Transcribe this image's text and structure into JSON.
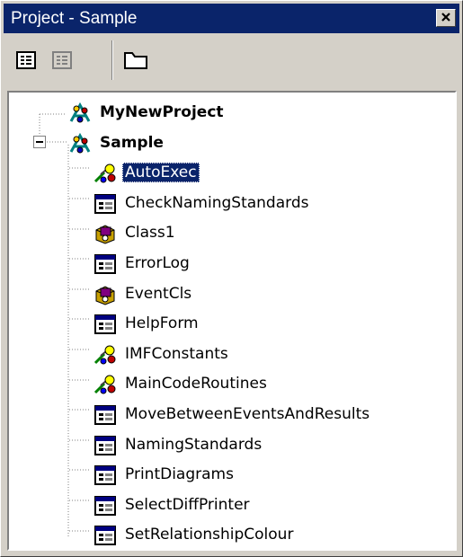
{
  "window": {
    "title": "Project - Sample",
    "accent_color": "#0a246a"
  },
  "toolbar": {
    "buttons": [
      {
        "name": "view-code-icon",
        "enabled": true
      },
      {
        "name": "view-object-icon",
        "enabled": false
      },
      {
        "name": "toggle-folders-icon",
        "enabled": true
      }
    ]
  },
  "tree": {
    "selected": "AutoExec",
    "projects": [
      {
        "label": "MyNewProject",
        "expanded": false,
        "icon": "project-icon"
      },
      {
        "label": "Sample",
        "expanded": true,
        "icon": "project-icon",
        "children": [
          {
            "label": "AutoExec",
            "icon": "macro-icon"
          },
          {
            "label": "CheckNamingStandards",
            "icon": "form-icon"
          },
          {
            "label": "Class1",
            "icon": "class-module-icon"
          },
          {
            "label": "ErrorLog",
            "icon": "form-icon"
          },
          {
            "label": "EventCls",
            "icon": "class-module-icon"
          },
          {
            "label": "HelpForm",
            "icon": "form-icon"
          },
          {
            "label": "IMFConstants",
            "icon": "macro-icon"
          },
          {
            "label": "MainCodeRoutines",
            "icon": "macro-icon"
          },
          {
            "label": "MoveBetweenEventsAndResults",
            "icon": "form-icon"
          },
          {
            "label": "NamingStandards",
            "icon": "form-icon"
          },
          {
            "label": "PrintDiagrams",
            "icon": "form-icon"
          },
          {
            "label": "SelectDiffPrinter",
            "icon": "form-icon"
          },
          {
            "label": "SetRelationshipColour",
            "icon": "form-icon"
          }
        ]
      }
    ]
  }
}
